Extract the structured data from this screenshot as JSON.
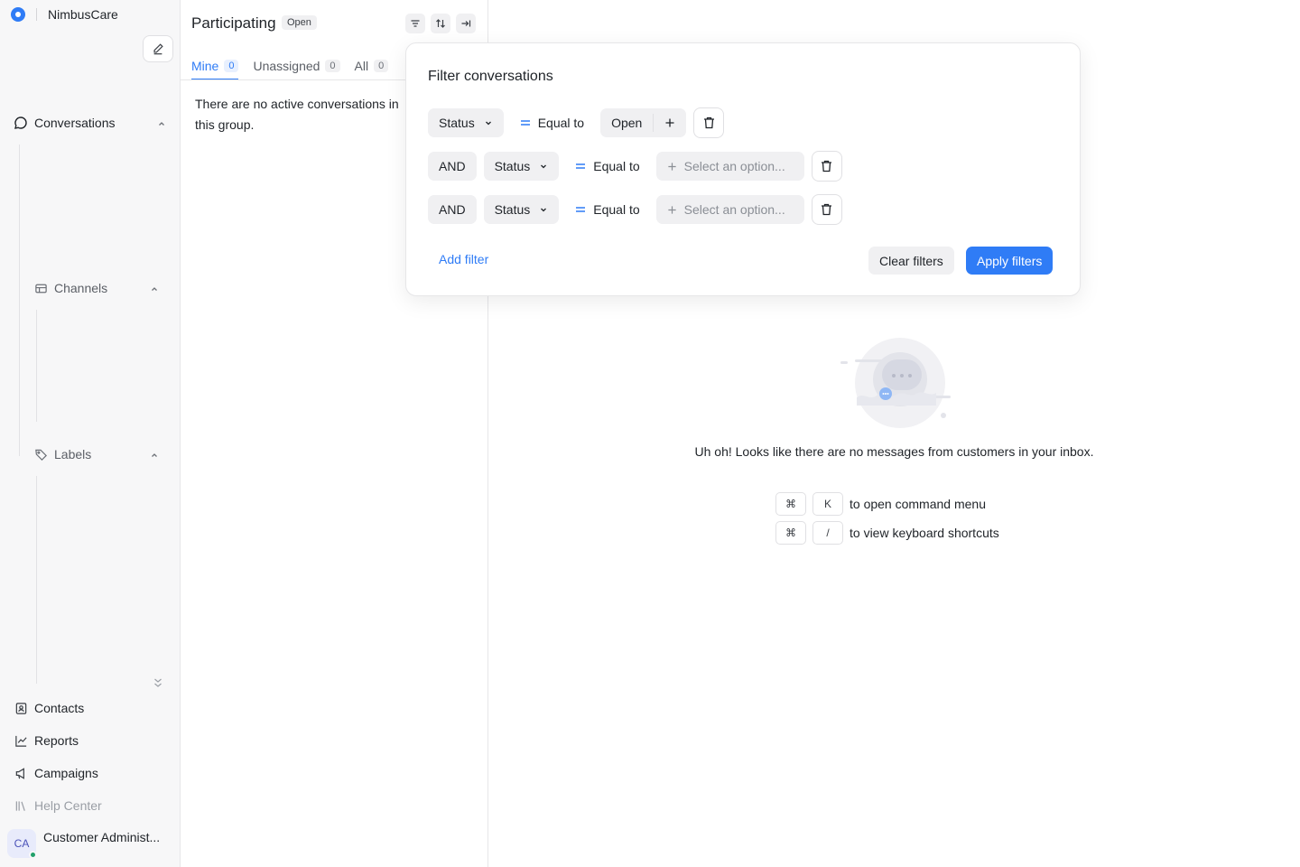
{
  "brand": {
    "name": "NimbusCare"
  },
  "sidebar": {
    "conversations": "Conversations",
    "channels": "Channels",
    "labels": "Labels",
    "bottom": [
      {
        "label": "Contacts",
        "icon": "contacts-icon"
      },
      {
        "label": "Reports",
        "icon": "reports-icon"
      },
      {
        "label": "Campaigns",
        "icon": "campaigns-icon"
      },
      {
        "label": "Help Center",
        "icon": "help-center-icon"
      }
    ],
    "user": {
      "initials": "CA",
      "name": "Customer Administ...",
      "status_color": "#22a06b"
    }
  },
  "list": {
    "title": "Participating",
    "status": "Open",
    "tabs": [
      {
        "label": "Mine",
        "count": "0"
      },
      {
        "label": "Unassigned",
        "count": "0"
      },
      {
        "label": "All",
        "count": "0"
      }
    ],
    "empty": "There are no active conversations in this group."
  },
  "main": {
    "empty_message": "Uh oh! Looks like there are no messages from customers in your inbox.",
    "shortcuts": [
      {
        "key1": "⌘",
        "key2": "K",
        "text": "to open command menu"
      },
      {
        "key1": "⌘",
        "key2": "/",
        "text": "to view keyboard shortcuts"
      }
    ]
  },
  "filter": {
    "title": "Filter conversations",
    "rows": [
      {
        "attribute": "Status",
        "operator": "Equal to",
        "value": "Open"
      },
      {
        "joiner": "AND",
        "attribute": "Status",
        "operator": "Equal to",
        "placeholder": "Select an option..."
      },
      {
        "joiner": "AND",
        "attribute": "Status",
        "operator": "Equal to",
        "placeholder": "Select an option..."
      }
    ],
    "add_filter": "Add filter",
    "clear": "Clear filters",
    "apply": "Apply filters"
  },
  "colors": {
    "accent": "#2f7cf6",
    "online": "#22a06b"
  }
}
